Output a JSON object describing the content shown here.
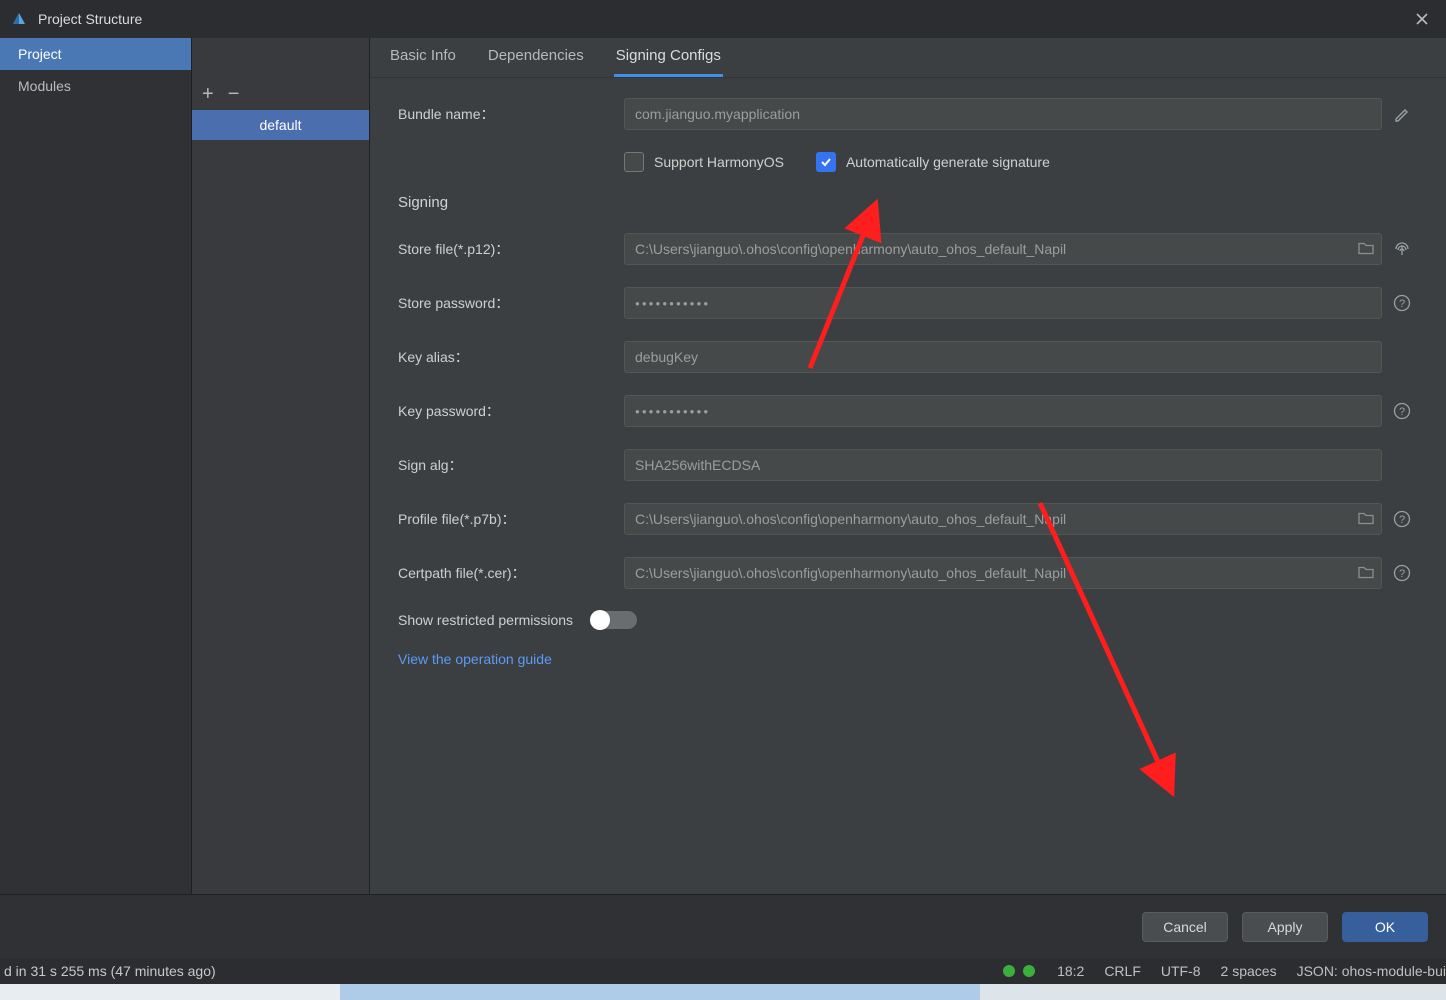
{
  "title": "Project Structure",
  "leftnav": {
    "items": [
      {
        "label": "Project",
        "selected": true
      },
      {
        "label": "Modules",
        "selected": false
      }
    ]
  },
  "midtool": {
    "add": "+",
    "remove": "−"
  },
  "midlist": {
    "items": [
      {
        "label": "default",
        "selected": true
      }
    ]
  },
  "tabs": [
    {
      "label": "Basic Info",
      "active": false
    },
    {
      "label": "Dependencies",
      "active": false
    },
    {
      "label": "Signing Configs",
      "active": true
    }
  ],
  "form": {
    "bundle_label": "Bundle name：",
    "bundle_value": "com.jianguo.myapplication",
    "support_label": "Support HarmonyOS",
    "autosig_label": "Automatically generate signature",
    "signing_header": "Signing",
    "storefile_label": "Store file(*.p12)：",
    "storefile_value": "C:\\Users\\jianguo\\.ohos\\config\\openharmony\\auto_ohos_default_Napil",
    "storepwd_label": "Store password：",
    "storepwd_value": "●●●●●●●●●●●",
    "keyalias_label": "Key alias：",
    "keyalias_value": "debugKey",
    "keypwd_label": "Key password：",
    "keypwd_value": "●●●●●●●●●●●",
    "signalg_label": "Sign alg：",
    "signalg_value": "SHA256withECDSA",
    "profile_label": "Profile file(*.p7b)：",
    "profile_value": "C:\\Users\\jianguo\\.ohos\\config\\openharmony\\auto_ohos_default_Napil",
    "cert_label": "Certpath file(*.cer)：",
    "cert_value": "C:\\Users\\jianguo\\.ohos\\config\\openharmony\\auto_ohos_default_Napil",
    "restricted_label": "Show restricted permissions",
    "guide_link": "View the operation guide"
  },
  "buttons": {
    "cancel": "Cancel",
    "apply": "Apply",
    "ok": "OK"
  },
  "status": {
    "msg": "d in 31 s 255 ms (47 minutes ago)",
    "cursor": "18:2",
    "crlf": "CRLF",
    "enc": "UTF-8",
    "indent": "2 spaces",
    "lang": "JSON: ohos-module-bui"
  }
}
